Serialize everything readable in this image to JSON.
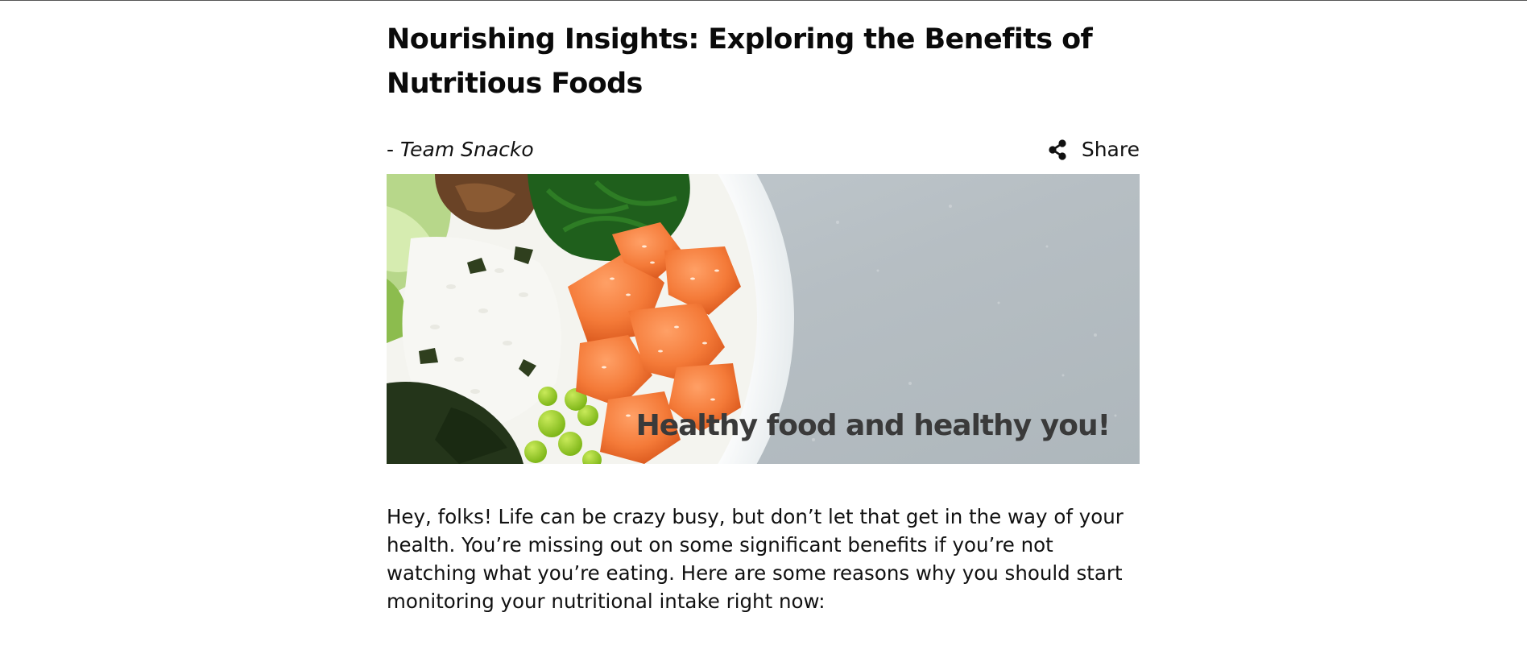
{
  "article": {
    "title": "Nourishing Insights: Exploring the Benefits of Nutritious Foods",
    "byline_prefix": "- ",
    "author": "Team Snacko",
    "share_label": "Share",
    "share_icon": "share-icon",
    "hero": {
      "image": "poke-bowl-photo",
      "caption": "Healthy food and healthy you!"
    },
    "intro": "Hey, folks! Life can be crazy busy, but don’t let that get in the way of your health. You’re missing out on some significant benefits if you’re not watching what you’re eating. Here are some reasons why you should start monitoring your nutritional intake right now:"
  },
  "colors": {
    "text": "#111111",
    "caption": "#3a3a3a",
    "background": "#ffffff"
  }
}
